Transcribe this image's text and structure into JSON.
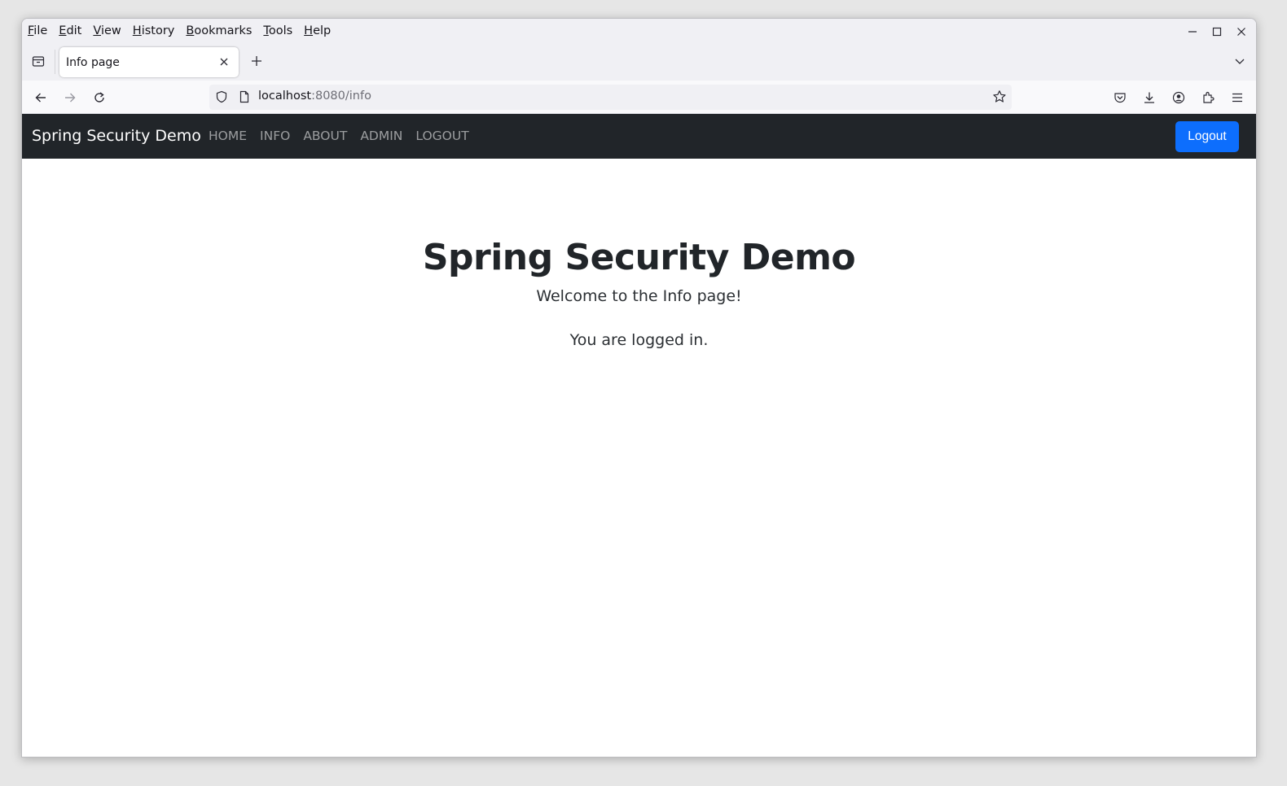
{
  "browser": {
    "menu": [
      {
        "label": "File",
        "key": "F",
        "rest": "ile"
      },
      {
        "label": "Edit",
        "key": "E",
        "rest": "dit"
      },
      {
        "label": "View",
        "key": "V",
        "rest": "iew"
      },
      {
        "label": "History",
        "key": "H",
        "rest": "istory"
      },
      {
        "label": "Bookmarks",
        "key": "B",
        "rest": "ookmarks"
      },
      {
        "label": "Tools",
        "key": "T",
        "rest": "ools"
      },
      {
        "label": "Help",
        "key": "H",
        "rest": "elp"
      }
    ],
    "tab": {
      "title": "Info page"
    },
    "url": {
      "host": "localhost",
      "path": ":8080/info"
    },
    "icons": {
      "back": "arrow-left-icon",
      "forward": "arrow-right-icon",
      "reload": "reload-icon",
      "shield": "shield-icon",
      "page": "page-icon",
      "bookmark": "star-icon",
      "pocket": "pocket-icon",
      "downloads": "download-icon",
      "account": "account-icon",
      "extensions": "extensions-icon",
      "menu": "hamburger-menu-icon"
    }
  },
  "site": {
    "brand": "Spring Security Demo",
    "nav": [
      "HOME",
      "INFO",
      "ABOUT",
      "ADMIN",
      "LOGOUT"
    ],
    "logout_button": "Logout",
    "accent": "#0d6efd",
    "navbar_bg": "#212529"
  },
  "main": {
    "title": "Spring Security Demo",
    "subtitle": "Welcome to the Info page!",
    "status": "You are logged in."
  }
}
